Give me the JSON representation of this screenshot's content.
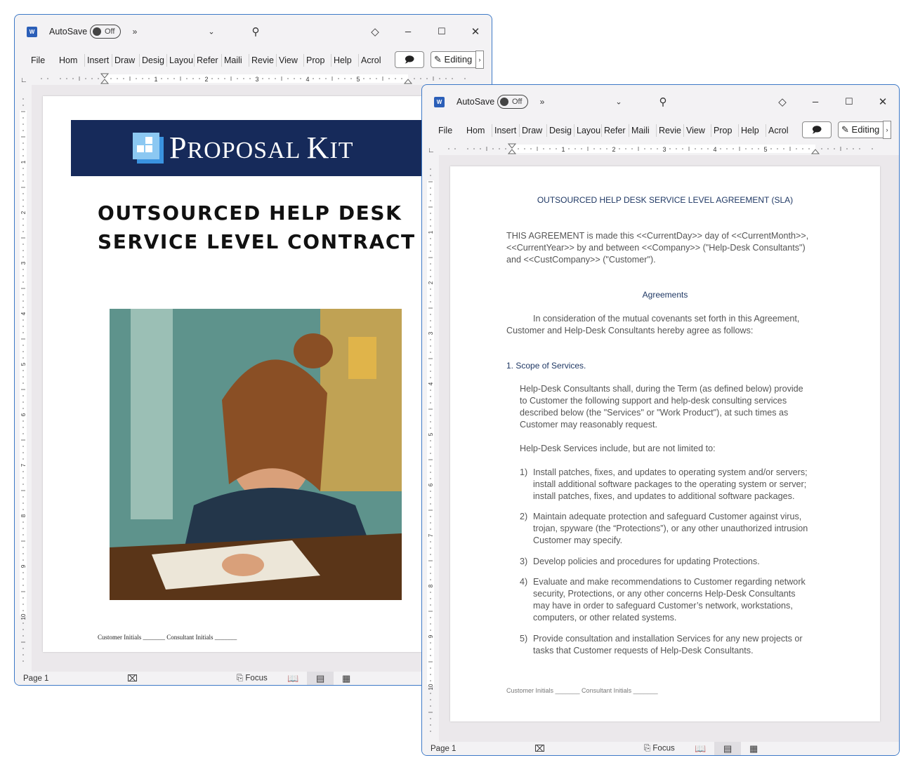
{
  "windows": [
    {
      "app_icon": "word-icon",
      "autosave_label": "AutoSave",
      "autosave_state": "Off",
      "more": "»",
      "editing_label": "Editing",
      "tabs": [
        "File",
        "Hom",
        "Insert",
        "Draw",
        "Desig",
        "Layou",
        "Refer",
        "Maili",
        "Revie",
        "View",
        "Prop",
        "Help",
        "Acrol"
      ],
      "ruler_numbers": [
        "1",
        "2",
        "3",
        "4",
        "5"
      ],
      "status_page": "Page 1",
      "focus_label": "Focus"
    },
    {
      "app_icon": "word-icon",
      "autosave_label": "AutoSave",
      "autosave_state": "Off",
      "more": "»",
      "editing_label": "Editing",
      "tabs": [
        "File",
        "Hom",
        "Insert",
        "Draw",
        "Desig",
        "Layou",
        "Refer",
        "Maili",
        "Revie",
        "View",
        "Prop",
        "Help",
        "Acrol"
      ],
      "ruler_numbers": [
        "1",
        "2",
        "3",
        "4",
        "5"
      ],
      "status_page": "Page 1",
      "focus_label": "Focus"
    }
  ],
  "cover": {
    "logo_text": "Proposal Kit",
    "logo_big": [
      "P",
      "K"
    ],
    "logo_small": [
      "ROPOSAL ",
      "I",
      "T"
    ],
    "title_lines": [
      "OUTSOURCED HELP DESK",
      "SERVICE LEVEL CONTRACT"
    ],
    "footer": "Customer Initials _______ Consultant Initials _______"
  },
  "agreement": {
    "title": "OUTSOURCED HELP DESK SERVICE LEVEL AGREEMENT (SLA)",
    "intro": [
      "THIS AGREEMENT is made this <<CurrentDay>> day of <<CurrentMonth>>,",
      "<<CurrentYear>> by and between <<Company>> (\"Help-Desk Consultants\")",
      "and <<CustCompany>> (\"Customer\")."
    ],
    "agreements_heading": "Agreements",
    "consideration": [
      "In consideration of the mutual covenants set forth in this Agreement,",
      "Customer and Help-Desk Consultants hereby agree as follows:"
    ],
    "section1_heading": "1. Scope of Services.",
    "scope": [
      "Help-Desk Consultants shall, during the Term (as defined below) provide",
      "to Customer the following support and help-desk consulting services",
      "described below (the \"Services\" or \"Work Product\"), at such times as",
      "Customer may reasonably request."
    ],
    "include": [
      "Help-Desk Services include, but are not limited to:"
    ],
    "items": [
      {
        "num": "1)",
        "lines": [
          "Install patches, fixes, and updates to operating system and/or servers;",
          "install additional software packages to the operating system or server;",
          "install patches, fixes, and updates to additional software packages."
        ]
      },
      {
        "num": "2)",
        "lines": [
          "Maintain adequate protection and safeguard Customer against virus,",
          "trojan, spyware (the “Protections”), or any other unauthorized intrusion",
          "Customer may specify."
        ]
      },
      {
        "num": "3)",
        "lines": [
          "Develop policies and procedures for updating Protections."
        ]
      },
      {
        "num": "4)",
        "lines": [
          "Evaluate and make recommendations to Customer regarding network",
          "security, Protections, or any other concerns Help-Desk Consultants",
          "may have in order to safeguard Customer’s network, workstations,",
          "computers, or other related systems."
        ]
      },
      {
        "num": "5)",
        "lines": [
          "Provide consultation and installation Services for any new projects or",
          "tasks that Customer requests of Help-Desk Consultants."
        ]
      }
    ],
    "footer": "Customer Initials _______ Consultant Initials _______"
  },
  "colors": {
    "window_border": "#3d79c7",
    "banner": "#162a5a",
    "heading": "#1f3864"
  }
}
